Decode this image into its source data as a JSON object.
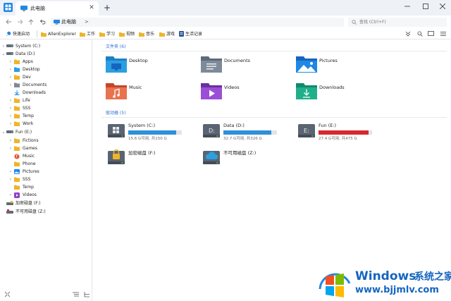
{
  "tab": {
    "label": "此电脑"
  },
  "address": {
    "path": "此电脑",
    "separator": ">",
    "search_placeholder": "查找 (Ctrl+F)"
  },
  "bookmarks": [
    {
      "label": "快速启动",
      "icon": "quick-launch-icon"
    },
    {
      "label": "AllenExplorer",
      "icon": "folder-icon"
    },
    {
      "label": "工作",
      "icon": "folder-icon"
    },
    {
      "label": "学习",
      "icon": "folder-icon"
    },
    {
      "label": "视频",
      "icon": "folder-icon"
    },
    {
      "label": "音乐",
      "icon": "folder-icon"
    },
    {
      "label": "游戏",
      "icon": "folder-icon"
    },
    {
      "label": "生活记录",
      "icon": "document-icon"
    }
  ],
  "sidebar": {
    "tree": [
      {
        "label": "System (C:)",
        "icon": "drive-icon",
        "expanded": false
      },
      {
        "label": "Data (D:)",
        "icon": "drive-icon",
        "expanded": true
      },
      {
        "label": "Apps",
        "icon": "folder-icon"
      },
      {
        "label": "Desktop",
        "icon": "desktop-folder-icon"
      },
      {
        "label": "Dev",
        "icon": "folder-icon"
      },
      {
        "label": "Documents",
        "icon": "documents-folder-icon"
      },
      {
        "label": "Downloads",
        "icon": "download-icon"
      },
      {
        "label": "Life",
        "icon": "folder-icon"
      },
      {
        "label": "SSS",
        "icon": "folder-icon"
      },
      {
        "label": "Temp",
        "icon": "folder-icon"
      },
      {
        "label": "Work",
        "icon": "folder-icon"
      },
      {
        "label": "Fun (E:)",
        "icon": "drive-icon",
        "expanded": true
      },
      {
        "label": "Fictions",
        "icon": "folder-icon"
      },
      {
        "label": "Games",
        "icon": "folder-icon"
      },
      {
        "label": "Music",
        "icon": "music-folder-icon"
      },
      {
        "label": "Phone",
        "icon": "folder-icon"
      },
      {
        "label": "Pictures",
        "icon": "pictures-folder-icon"
      },
      {
        "label": "SSS",
        "icon": "folder-icon"
      },
      {
        "label": "Temp",
        "icon": "folder-icon"
      },
      {
        "label": "Videos",
        "icon": "videos-folder-icon"
      },
      {
        "label": "加密磁盘 (F:)",
        "icon": "locked-drive-icon"
      },
      {
        "label": "不可用磁盘 (Z:)",
        "icon": "unavailable-drive-icon"
      }
    ]
  },
  "folders_section": {
    "header": "文件夹 (6)",
    "items": [
      {
        "label": "Desktop",
        "icon": "desktop-folder-icon"
      },
      {
        "label": "Documents",
        "icon": "documents-folder-icon"
      },
      {
        "label": "Pictures",
        "icon": "pictures-folder-icon"
      },
      {
        "label": "Music",
        "icon": "music-folder-icon"
      },
      {
        "label": "Videos",
        "icon": "videos-folder-icon"
      },
      {
        "label": "Downloads",
        "icon": "downloads-folder-icon"
      }
    ]
  },
  "drives_section": {
    "header": "驱动器 (5)",
    "items": [
      {
        "label": "System (C:)",
        "size_text": "15.6 G可用, 共150 G",
        "used_fraction": 0.9,
        "icon": "windows-drive-icon",
        "bar_color": "#2f8fd8"
      },
      {
        "label": "Data (D:)",
        "size_text": "32.7 G可用, 共326 G",
        "used_fraction": 0.9,
        "icon": "d-drive-icon",
        "bar_color": "#2f8fd8"
      },
      {
        "label": "Fun (E:)",
        "size_text": "27.4 G可用, 共475 G",
        "used_fraction": 0.94,
        "icon": "e-drive-icon",
        "bar_color": "#d9272e"
      },
      {
        "label": "加密磁盘 (F:)",
        "size_text": "",
        "used_fraction": null,
        "icon": "locked-drive-icon"
      },
      {
        "label": "不可用磁盘 (Z:)",
        "size_text": "",
        "used_fraction": null,
        "icon": "cloud-drive-icon"
      }
    ]
  },
  "watermark": {
    "brand": "Windows",
    "cn": "系统之家",
    "url": "www.bjjmlv.com"
  },
  "colors": {
    "accent": "#2a6fd6",
    "titlebar": "#eef2f7",
    "folder": "#f0b429",
    "bar_blue": "#2f8fd8",
    "bar_red": "#d9272e"
  }
}
